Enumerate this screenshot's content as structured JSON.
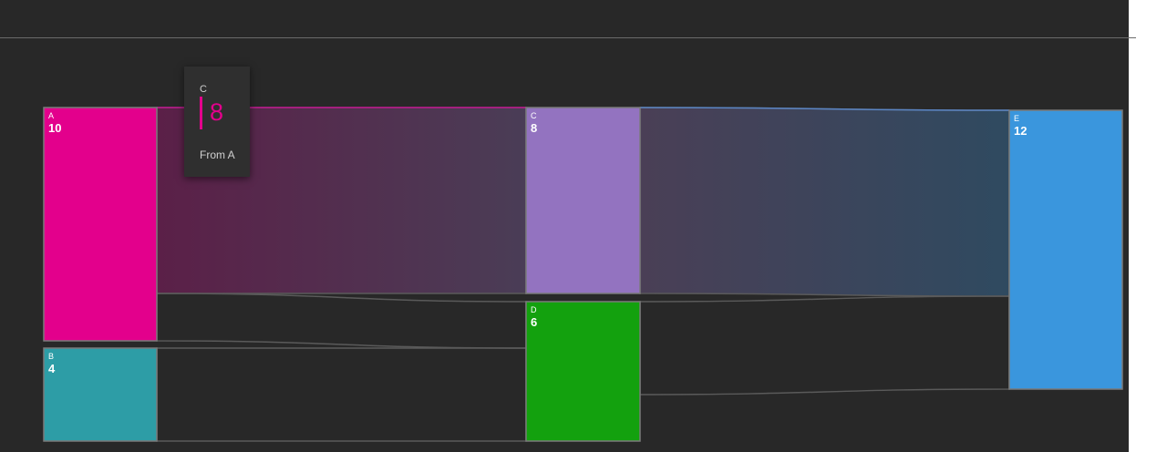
{
  "nodes": [
    {
      "id": "A",
      "label": "A",
      "value": "10",
      "color": "#e3008c"
    },
    {
      "id": "B",
      "label": "B",
      "value": "4",
      "color": "#2d9da6"
    },
    {
      "id": "C",
      "label": "C",
      "value": "8",
      "color": "#9373c0"
    },
    {
      "id": "D",
      "label": "D",
      "value": "6",
      "color": "#13a10e"
    },
    {
      "id": "E",
      "label": "E",
      "value": "12",
      "color": "#3a96dd"
    }
  ],
  "links": [
    {
      "from": "A",
      "to": "C",
      "value": 8
    },
    {
      "from": "A",
      "to": "D",
      "value": 2
    },
    {
      "from": "B",
      "to": "D",
      "value": 4
    },
    {
      "from": "C",
      "to": "E",
      "value": 8
    },
    {
      "from": "D",
      "to": "E",
      "value": 4
    }
  ],
  "tooltip": {
    "node": "C",
    "value": "8",
    "description": "From A",
    "accent": "#e3008c"
  },
  "colors": {
    "background": "#282828",
    "link_stroke": "#5a5a5a",
    "node_border": "#7a7a7a"
  }
}
